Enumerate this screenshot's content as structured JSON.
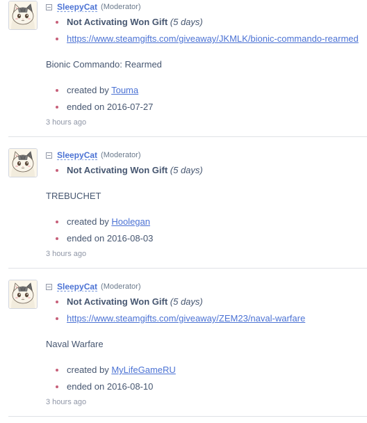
{
  "comments": [
    {
      "username": "SleepyCat",
      "role": "(Moderator)",
      "reason": "Not Activating Won Gift",
      "days": "(5 days)",
      "link": "https://www.steamgifts.com/giveaway/JKMLK/bionic-commando-rearmed",
      "game": "Bionic Commando: Rearmed",
      "created_prefix": "created by",
      "creator": "Touma",
      "ended": "ended on 2016-07-27",
      "time": "3 hours ago"
    },
    {
      "username": "SleepyCat",
      "role": "(Moderator)",
      "reason": "Not Activating Won Gift",
      "days": "(5 days)",
      "game": "TREBUCHET",
      "created_prefix": "created by",
      "creator": "Hoolegan",
      "ended": "ended on 2016-08-03",
      "time": "3 hours ago"
    },
    {
      "username": "SleepyCat",
      "role": "(Moderator)",
      "reason": "Not Activating Won Gift",
      "days": "(5 days)",
      "link": "https://www.steamgifts.com/giveaway/ZEM23/naval-warfare",
      "game": "Naval Warfare",
      "created_prefix": "created by",
      "creator": "MyLifeGameRU",
      "ended": "ended on 2016-08-10",
      "time": "3 hours ago"
    }
  ],
  "colors": {
    "link": "#4b72d4",
    "bullet": "#c7607a",
    "text": "#465670",
    "muted": "#8f96a6",
    "divider": "#dfe2e6"
  },
  "icons": {
    "avatar": "cat-avatar",
    "collapse": "collapse-minus-icon",
    "bullet": "bullet-dot-icon"
  }
}
